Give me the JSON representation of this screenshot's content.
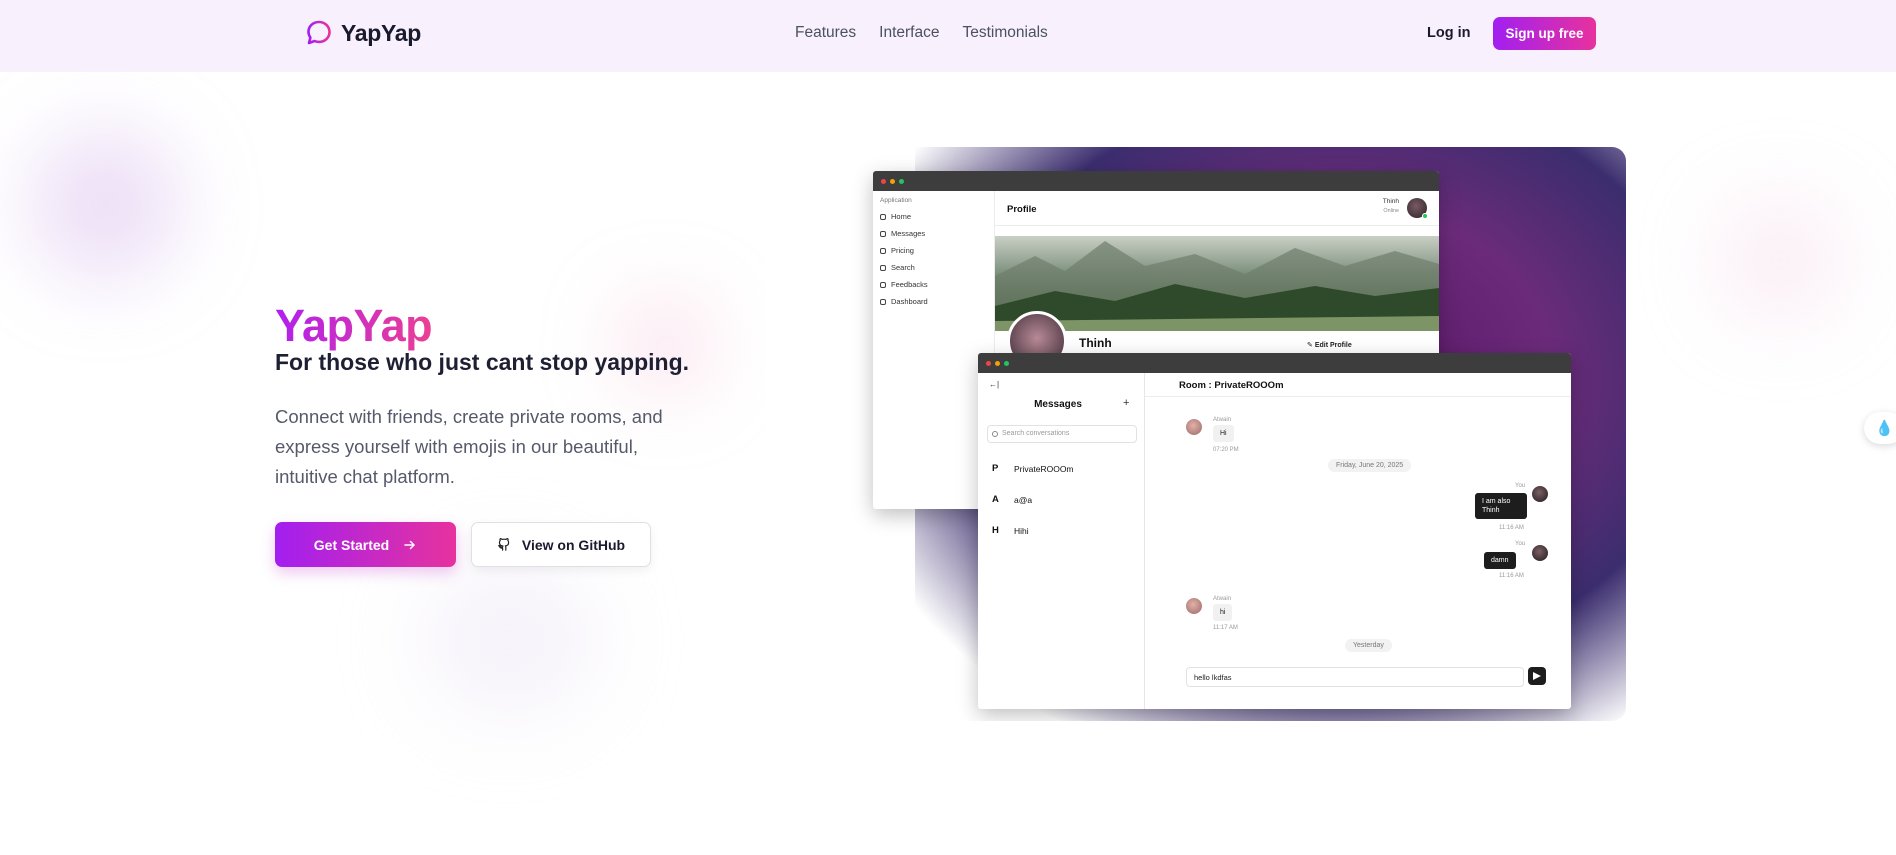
{
  "nav": {
    "brand": "YapYap",
    "links": [
      "Features",
      "Interface",
      "Testimonials"
    ],
    "login": "Log in",
    "signup": "Sign up free"
  },
  "hero": {
    "title": "YapYap",
    "subtitle": "For those who just cant stop yapping.",
    "description": "Connect with friends, create private rooms, and express yourself with emojis in our beautiful, intuitive chat platform.",
    "cta_primary": "Get Started",
    "cta_secondary": "View on GitHub"
  },
  "mockup": {
    "profile_window": {
      "group_label": "Application",
      "menu": [
        "Home",
        "Messages",
        "Pricing",
        "Search",
        "Feedbacks",
        "Dashboard"
      ],
      "header_title": "Profile",
      "user_name": "Thinh",
      "user_status": "Online",
      "profile_name": "Thinh",
      "edit_label": "Edit Profile"
    },
    "chat_window": {
      "back": "←|",
      "title": "Messages",
      "add": "+",
      "search_placeholder": "Search conversations",
      "conversations": [
        {
          "initial": "P",
          "name": "PrivateROOOm"
        },
        {
          "initial": "A",
          "name": "a@a"
        },
        {
          "initial": "H",
          "name": "Hihi"
        }
      ],
      "room_title": "Room : PrivateROOOm",
      "messages": {
        "m1_sender": "Atwain",
        "m1_text": "Hi",
        "m1_time": "07:20 PM",
        "date1": "Friday, June 20, 2025",
        "m2_sender": "You",
        "m2_text": "I am also Thinh",
        "m2_time": "11:16 AM",
        "m3_sender": "You",
        "m3_text": "damn",
        "m3_time": "11:16 AM",
        "m4_sender": "Atwain",
        "m4_text": "hi",
        "m4_time": "11:17 AM",
        "date2": "Yesterday"
      },
      "input_value": "hello lkdfas"
    }
  },
  "colors": {
    "gradient_start": "#a21ff0",
    "gradient_end": "#e7329e",
    "nav_bg": "#f8f0fc"
  }
}
